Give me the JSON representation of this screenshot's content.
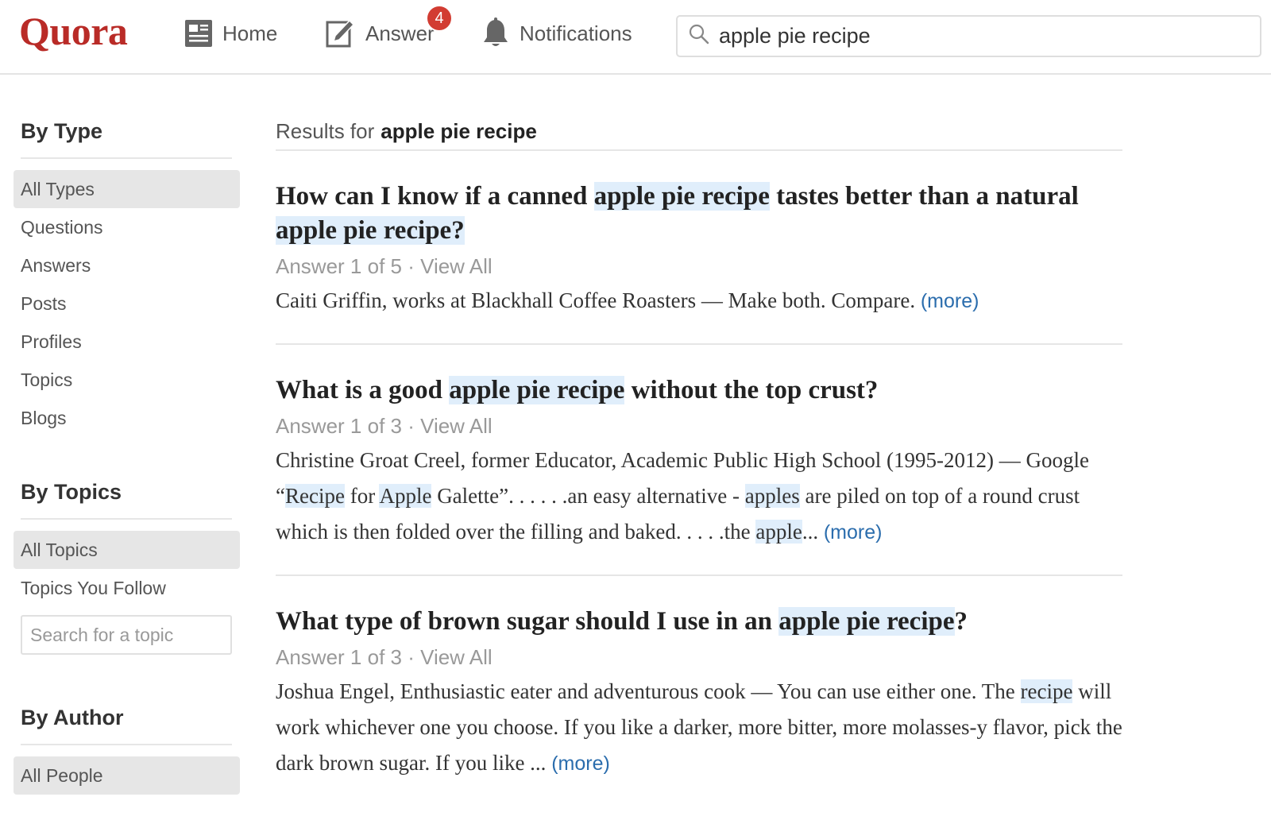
{
  "header": {
    "logo": "Quora",
    "nav": {
      "home": "Home",
      "answer": "Answer",
      "answer_badge": "4",
      "notifications": "Notifications"
    },
    "search_value": "apple pie recipe",
    "brand_color": "#b92b27",
    "icons": [
      "news-feed-icon",
      "pen-icon",
      "bell-icon",
      "search-icon"
    ]
  },
  "sidebar": {
    "by_type": {
      "heading": "By Type",
      "items": [
        "All Types",
        "Questions",
        "Answers",
        "Posts",
        "Profiles",
        "Topics",
        "Blogs"
      ],
      "active": "All Types"
    },
    "by_topics": {
      "heading": "By Topics",
      "items": [
        "All Topics",
        "Topics You Follow"
      ],
      "active": "All Topics",
      "search_placeholder": "Search for a topic"
    },
    "by_author": {
      "heading": "By Author",
      "items": [
        "All People"
      ],
      "active": "All People"
    }
  },
  "main": {
    "results_prefix": "Results for",
    "results_query": "apple pie recipe",
    "more_label": "(more)",
    "highlight_color": "#e0eefb",
    "link_color": "#2b6dad",
    "results": [
      {
        "title": [
          {
            "t": "How can I know if a canned "
          },
          {
            "t": "apple pie recipe",
            "hl": true
          },
          {
            "t": " tastes better than a natural "
          },
          {
            "t": "apple pie recipe?",
            "hl": true
          }
        ],
        "meta": "Answer 1 of 5 · View All",
        "snippet": [
          {
            "t": "Caiti Griffin, works at Blackhall Coffee Roasters — Make both. Compare. "
          }
        ]
      },
      {
        "title": [
          {
            "t": "What is a good "
          },
          {
            "t": "apple pie recipe",
            "hl": true
          },
          {
            "t": " without the top crust?"
          }
        ],
        "meta": "Answer 1 of 3 · View All",
        "snippet": [
          {
            "t": "Christine Groat Creel, former Educator, Academic Public High School (1995-2012) — Google “"
          },
          {
            "t": "Recipe",
            "hl": true
          },
          {
            "t": " for "
          },
          {
            "t": "Apple",
            "hl": true
          },
          {
            "t": " Galette”. . . . . .an easy alternative - "
          },
          {
            "t": "apples",
            "hl": true
          },
          {
            "t": " are piled on top of a round crust which is then folded over the filling and baked. . . . .the "
          },
          {
            "t": "apple",
            "hl": true
          },
          {
            "t": "... "
          }
        ]
      },
      {
        "title": [
          {
            "t": "What type of brown sugar should I use in an "
          },
          {
            "t": "apple pie recipe",
            "hl": true
          },
          {
            "t": "?"
          }
        ],
        "meta": "Answer 1 of 3 · View All",
        "snippet": [
          {
            "t": "Joshua Engel, Enthusiastic eater and adventurous cook — You can use either one.  The "
          },
          {
            "t": "recipe",
            "hl": true
          },
          {
            "t": " will work whichever one you choose.  If you like a darker, more bitter, more molasses-y flavor, pick the dark brown sugar.  If you like ... "
          }
        ]
      }
    ]
  }
}
